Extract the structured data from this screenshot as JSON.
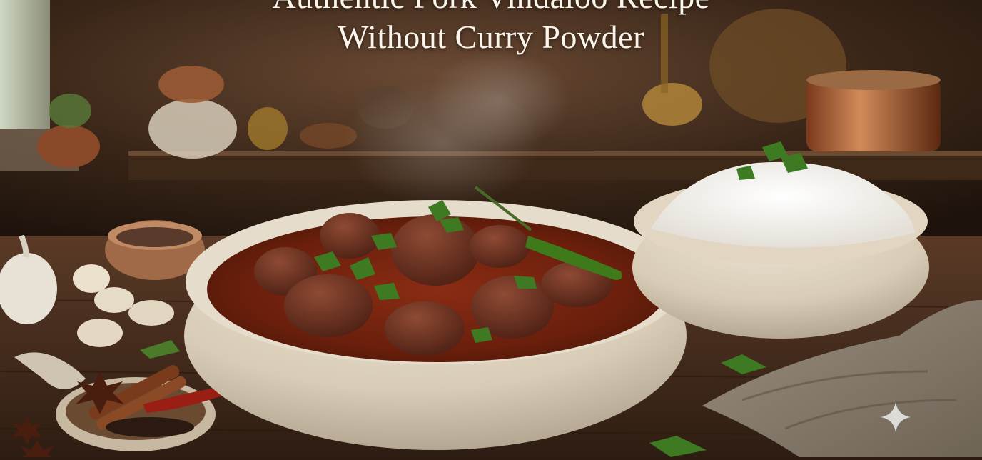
{
  "title": {
    "line1": "Authentic Pork Vindaloo Recipe",
    "line2": "Without Curry Powder"
  },
  "icons": {
    "corner_mark": "sparkle-icon"
  }
}
